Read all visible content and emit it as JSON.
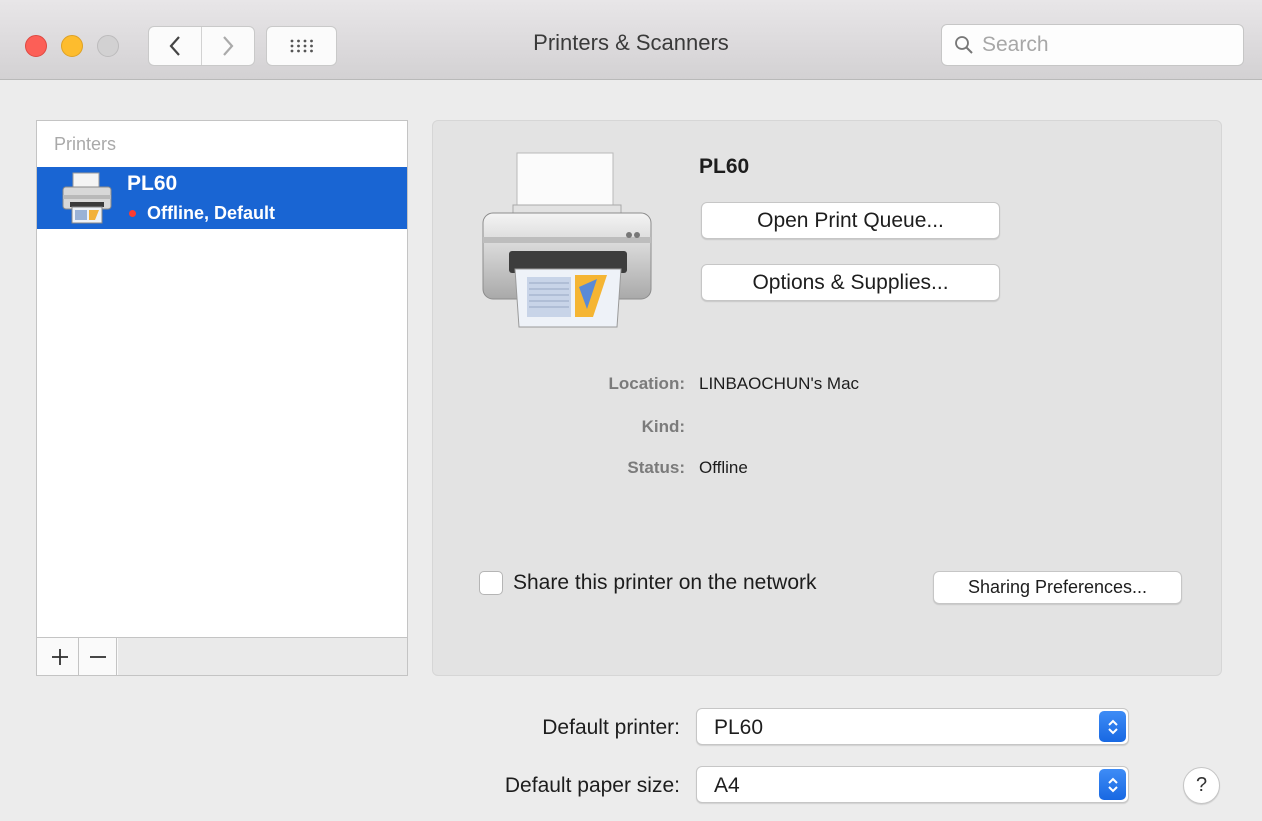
{
  "window": {
    "title": "Printers & Scanners",
    "search_placeholder": "Search"
  },
  "printers_list": {
    "header": "Printers",
    "items": [
      {
        "name": "PL60",
        "status": "Offline, Default",
        "selected": true,
        "status_color": "#ff3b30"
      }
    ],
    "add_label": "+",
    "remove_label": "−"
  },
  "detail": {
    "printer_name": "PL60",
    "open_queue_label": "Open Print Queue...",
    "options_label": "Options & Supplies...",
    "info": [
      {
        "key": "Location:",
        "value": "LINBAOCHUN's Mac"
      },
      {
        "key": "Kind:",
        "value": ""
      },
      {
        "key": "Status:",
        "value": "Offline"
      }
    ],
    "share_label": "Share this printer on the network",
    "share_checked": false,
    "sharing_prefs_label": "Sharing Preferences..."
  },
  "footer": {
    "default_printer_label": "Default printer:",
    "default_printer_value": "PL60",
    "paper_size_label": "Default paper size:",
    "paper_size_value": "A4",
    "help_label": "?"
  },
  "colors": {
    "selection": "#1965d3",
    "accent": "#1868e2"
  }
}
